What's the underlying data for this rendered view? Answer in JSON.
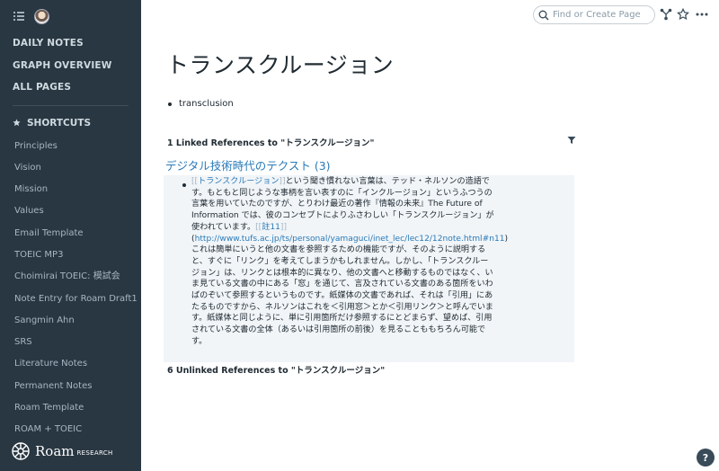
{
  "sidebar": {
    "nav": [
      "DAILY NOTES",
      "GRAPH OVERVIEW",
      "ALL PAGES"
    ],
    "shortcuts_label": "SHORTCUTS",
    "shortcuts": [
      "Principles",
      "Vision",
      "Mission",
      "Values",
      "Email Template",
      "TOEIC MP3",
      "Choimirai TOEIC: 模試会",
      "Note Entry for Roam Draft1",
      "Sangmin Ahn",
      "SRS",
      "Literature Notes",
      "Permanent Notes",
      "Roam Template",
      "ROAM + TOEIC"
    ],
    "logo_word": "Roam",
    "logo_sub": "RESEARCH"
  },
  "topbar": {
    "search_placeholder": "Find or Create Page"
  },
  "page": {
    "title": "トランスクルージョン",
    "blocks": [
      "transclusion"
    ]
  },
  "linked_refs": {
    "header": "1 Linked References to \"トランスクルージョン\"",
    "group_title": "デジタル技術時代のテクスト (3)",
    "block": {
      "open_bracket": "[[",
      "link_text": "トランスクルージョン",
      "close_bracket": "]]",
      "line1_rest": "という聞き慣れない言葉は、テッド・ネルソンの造語で",
      "line2": "す。もともと同じような事柄を言い表すのに「インクルージョン」というふつうの",
      "line3": "言葉を用いていたのですが、とりわけ最近の著作『情報の未来』The Future of",
      "line4": "Information では、彼のコンセプトによりふさわしい「トランスクルージョン」が",
      "line5_text": "使われています。",
      "note_open": "[[",
      "note_link": "註11",
      "note_close": "]]",
      "url_open": "(",
      "url": "http://www.tufs.ac.jp/ts/personal/yamaguci/inet_lec/lec12/12note.html#n11",
      "url_close": ")",
      "line7": "これは簡単にいうと他の文書を参照するための機能ですが、そのように説明する",
      "line8": "と、すぐに「リンク」を考えてしまうかもしれません。しかし、「トランスクルー",
      "line9": "ジョン」は、リンクとは根本的に異なり、他の文書へと移動するものではなく、い",
      "line10": "ま見ている文書の中にある「窓」を通じて、言及されている文書のある箇所をいわ",
      "line11": "ばのぞいて参照するというものです。紙媒体の文書であれば、それは「引用」にあ",
      "line12": "たるものですから、ネルソンはこれを＜引用窓＞とか＜引用リンク＞と呼んでいま",
      "line13": "す。紙媒体と同じように、単に引用箇所だけ参照するにとどまらず、望めば、引用",
      "line14": "されている文書の全体（あるいは引用箇所の前後）を見ることももちろん可能で",
      "line15": "す。"
    }
  },
  "unlinked_refs": {
    "header": "6 Unlinked References to \"トランスクルージョン\""
  },
  "help": {
    "label": "?"
  },
  "colors": {
    "sidebar_bg": "#293742",
    "link": "#2a7ab8",
    "ref_bg": "#f1f5f8"
  }
}
